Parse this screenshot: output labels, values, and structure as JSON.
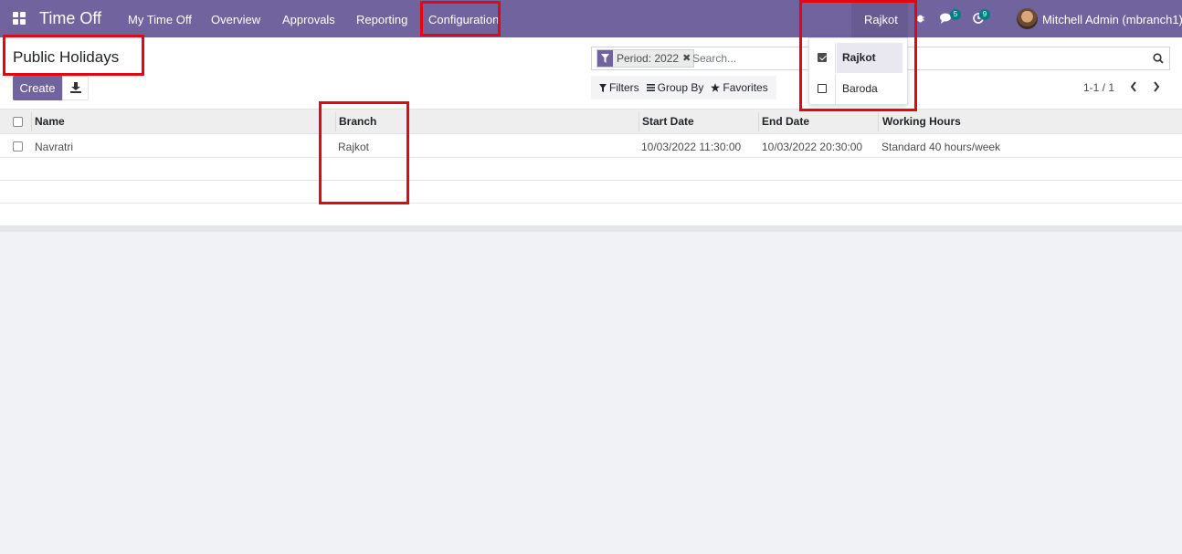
{
  "navbar": {
    "app_name": "Time Off",
    "menu": [
      "My Time Off",
      "Overview",
      "Approvals",
      "Reporting",
      "Configuration"
    ],
    "current_branch": "Rajkot",
    "messages_badge": "5",
    "activities_badge": "9",
    "user_name": "Mitchell Admin (mbranch1)"
  },
  "control_panel": {
    "title": "Public Holidays",
    "create_label": "Create",
    "facet_label": "Period: 2022",
    "facet_remove": "✖",
    "search_placeholder": "Search...",
    "filters_label": "Filters",
    "group_by_label": "Group By",
    "favorites_label": "Favorites",
    "pager_value": "1-1 / 1"
  },
  "branch_dropdown": {
    "items": [
      {
        "label": "Rajkot",
        "checked": true
      },
      {
        "label": "Baroda",
        "checked": false
      }
    ]
  },
  "table": {
    "columns": [
      "Name",
      "Branch",
      "Start Date",
      "End Date",
      "Working Hours"
    ],
    "rows": [
      [
        "Navratri",
        "Rajkot",
        "10/03/2022 11:30:00",
        "10/03/2022 20:30:00",
        "Standard 40 hours/week"
      ]
    ]
  },
  "colors": {
    "primary": "#71639e",
    "annotation": "#e30613",
    "badge": "#017e84"
  }
}
